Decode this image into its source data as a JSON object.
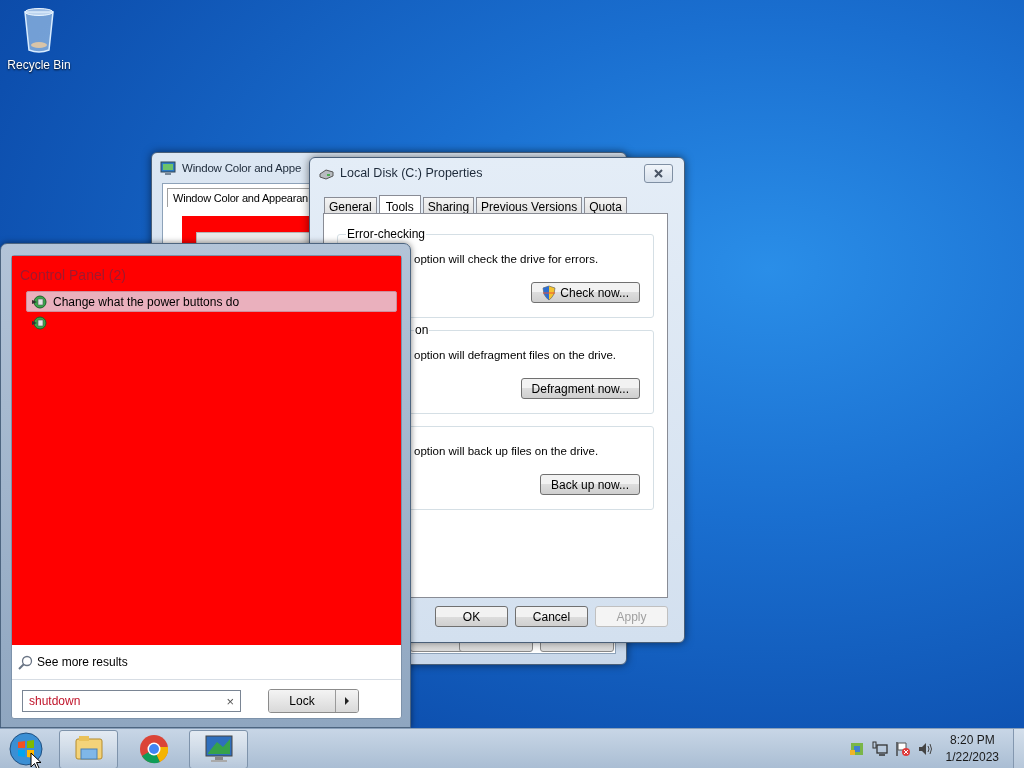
{
  "desktop_icons": [
    {
      "label": "Recycle Bin"
    }
  ],
  "back_window": {
    "title": "Window Color and Appe",
    "tab": "Window Color and Appearan"
  },
  "properties_window": {
    "title": "Local Disk (C:) Properties",
    "tabs": [
      {
        "label": "General",
        "selected": false
      },
      {
        "label": "Tools",
        "selected": true
      },
      {
        "label": "Sharing",
        "selected": false
      },
      {
        "label": "Previous Versions",
        "selected": false
      },
      {
        "label": "Quota",
        "selected": false
      }
    ],
    "groups": [
      {
        "title": "Error-checking",
        "description": "option will check the drive for errors.",
        "button": "Check now...",
        "shield": true
      },
      {
        "title": "on",
        "description": "option will defragment files on the drive.",
        "button": "Defragment now...",
        "shield": false
      },
      {
        "description": "option will back up files on the drive.",
        "button": "Back up now...",
        "shield": false
      }
    ],
    "buttons": [
      {
        "label": "OK",
        "disabled": false
      },
      {
        "label": "Cancel",
        "disabled": false
      },
      {
        "label": "Apply",
        "disabled": true
      }
    ]
  },
  "start_menu": {
    "section_title": "Control Panel (2)",
    "results": [
      {
        "label": "Change what the power buttons do",
        "selected": true
      },
      {
        "selected": false
      }
    ],
    "see_more": "See more results",
    "search": {
      "value": "shutdown",
      "clear": "×"
    },
    "power_button": {
      "label": "Lock"
    }
  },
  "taskbar": {
    "apps": [
      {
        "kind": "explorer",
        "running": true
      },
      {
        "kind": "chrome",
        "running": false
      },
      {
        "kind": "display",
        "running": true
      }
    ],
    "clock": {
      "time": "8:20 PM",
      "date": "1/22/2023"
    }
  }
}
